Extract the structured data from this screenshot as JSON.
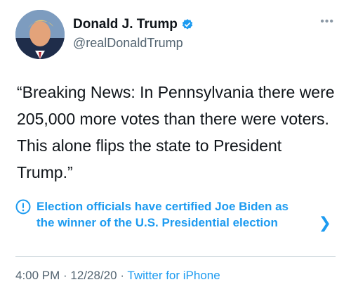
{
  "author": {
    "display_name": "Donald J. Trump",
    "handle": "@realDonaldTrump"
  },
  "icons": {
    "verified": "verified-badge-icon",
    "more": "more-options-icon",
    "info": "info-circle-icon",
    "chevron": "chevron-right-icon"
  },
  "tweet": {
    "text": "“Breaking News: In Pennsylvania there were 205,000 more votes than there were voters. This alone flips the state to President Trump.”"
  },
  "label": {
    "text": "Election officials have certified Joe Biden as the winner of the U.S. Presidential election"
  },
  "meta": {
    "time": "4:00 PM",
    "sep1": " · ",
    "date": "12/28/20",
    "sep2": " · ",
    "source": "Twitter for iPhone"
  },
  "colors": {
    "accent": "#1d9bf0",
    "text": "#0f1419",
    "muted": "#536471"
  }
}
